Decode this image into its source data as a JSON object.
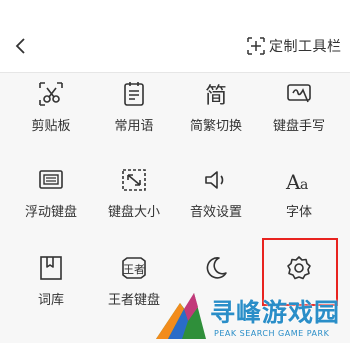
{
  "header": {
    "back_icon": "chevron-left-icon",
    "customize_label": "定制工具栏",
    "customize_icon": "add-box-icon"
  },
  "tools": [
    {
      "label": "剪贴板",
      "icon": "scissors-icon"
    },
    {
      "label": "常用语",
      "icon": "notes-icon"
    },
    {
      "label": "简繁切换",
      "icon": "jian-char-icon"
    },
    {
      "label": "键盘手写",
      "icon": "handwriting-icon"
    },
    {
      "label": "浮动键盘",
      "icon": "floating-keyboard-icon"
    },
    {
      "label": "键盘大小",
      "icon": "resize-icon"
    },
    {
      "label": "音效设置",
      "icon": "speaker-icon"
    },
    {
      "label": "字体",
      "icon": "font-icon"
    },
    {
      "label": "词库",
      "icon": "dictionary-icon"
    },
    {
      "label": "王者键盘",
      "icon": "king-keyboard-icon"
    },
    {
      "label": "",
      "icon": "moon-icon"
    },
    {
      "label": "",
      "icon": "gear-icon"
    }
  ],
  "watermark": {
    "title": "寻峰游戏园",
    "subtitle": "PEAK SEARCH GAME PARK"
  },
  "colors": {
    "highlight": "#e8231f",
    "watermark": "#2a8ec8"
  }
}
